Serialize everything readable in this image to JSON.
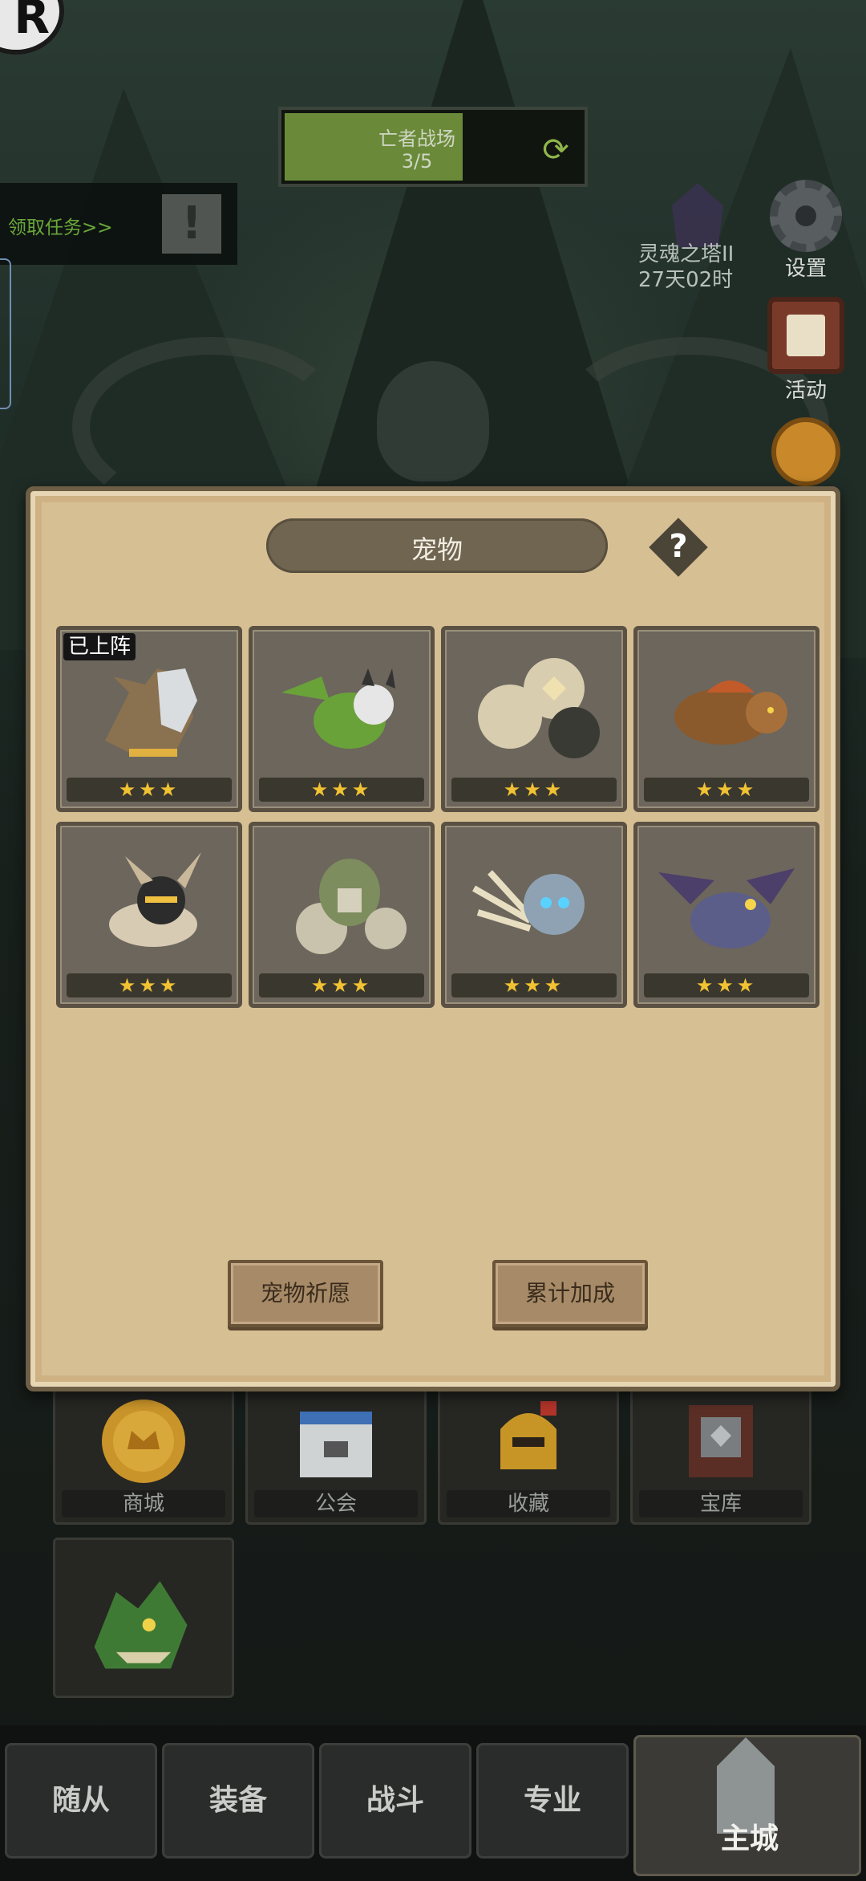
{
  "hud": {
    "logo_letter": "R",
    "stage_name": "亡者战场",
    "stage_progress": "3/5",
    "quest_label": "领取任务>>",
    "tower_name": "灵魂之塔II",
    "tower_time": "27天02时",
    "settings_label": "设置",
    "event_label": "活动"
  },
  "panel": {
    "title": "宠物",
    "help_glyph": "?",
    "pets": [
      {
        "stars": 3,
        "badge": "已上阵",
        "icon": "griffin-pet-icon",
        "color": "#8a7150"
      },
      {
        "stars": 3,
        "badge": "",
        "icon": "green-dragon-pet-icon",
        "color": "#6aa23a"
      },
      {
        "stars": 3,
        "badge": "",
        "icon": "stone-golem-pet-icon",
        "color": "#d9cdb0"
      },
      {
        "stars": 3,
        "badge": "",
        "icon": "boar-pet-icon",
        "color": "#8a5a2c"
      },
      {
        "stars": 3,
        "badge": "",
        "icon": "fennec-pet-icon",
        "color": "#d8cbb3"
      },
      {
        "stars": 3,
        "badge": "",
        "icon": "moss-golem-pet-icon",
        "color": "#7d8d5e"
      },
      {
        "stars": 3,
        "badge": "",
        "icon": "skeleton-wolf-pet-icon",
        "color": "#8fa2b3"
      },
      {
        "stars": 3,
        "badge": "",
        "icon": "gargoyle-pet-icon",
        "color": "#5c5e8a"
      }
    ],
    "wish_button": "宠物祈愿",
    "bonus_button": "累计加成"
  },
  "city_tiles": [
    {
      "label": "商城",
      "icon": "coin-icon"
    },
    {
      "label": "公会",
      "icon": "guild-hall-icon"
    },
    {
      "label": "收藏",
      "icon": "helmet-icon"
    },
    {
      "label": "宝库",
      "icon": "treasury-icon"
    },
    {
      "label": "",
      "icon": "dragon-head-icon"
    }
  ],
  "nav": {
    "followers": "随从",
    "equipment": "装备",
    "battle": "战斗",
    "profession": "专业",
    "main_city": "主城"
  }
}
